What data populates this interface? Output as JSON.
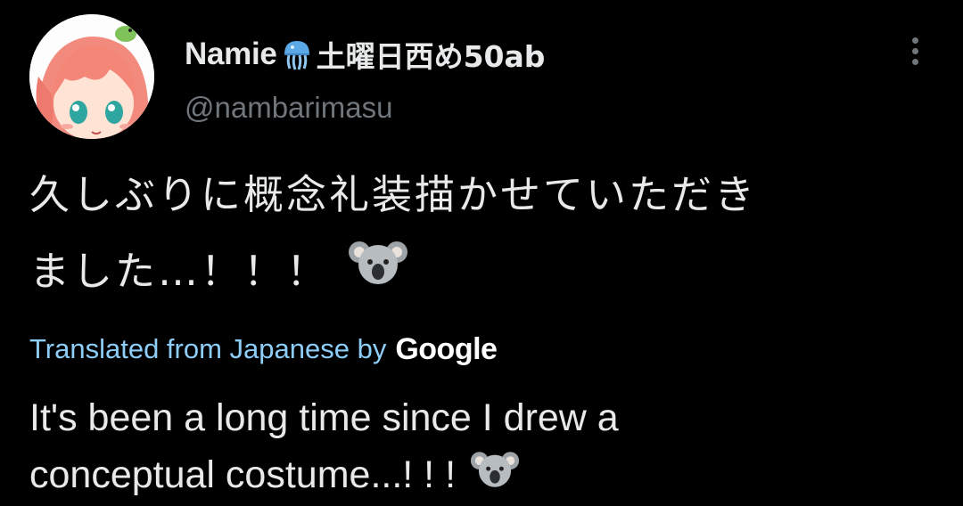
{
  "tweet": {
    "author": {
      "name_prefix": "Namie",
      "name_emoji": "jellyfish-emoji",
      "name_suffix": "土曜日西め50ab",
      "handle": "@nambarimasu"
    },
    "original_text": {
      "line1": "久しぶりに概念礼装描かせていただき",
      "line2": "ました…！！！",
      "emoji": "koala-emoji"
    },
    "translation_label": "Translated from Japanese by",
    "translation_provider": "Google",
    "translated_text": {
      "line1": "It's been a long time since I drew a",
      "line2": "conceptual costume...! ! !",
      "emoji": "koala-emoji"
    },
    "icons": {
      "more": "more-vertical-icon"
    }
  },
  "colors": {
    "background": "#000000",
    "primary_text": "#e7e9ea",
    "secondary_text": "#71767b",
    "link": "#8ecdf8"
  }
}
